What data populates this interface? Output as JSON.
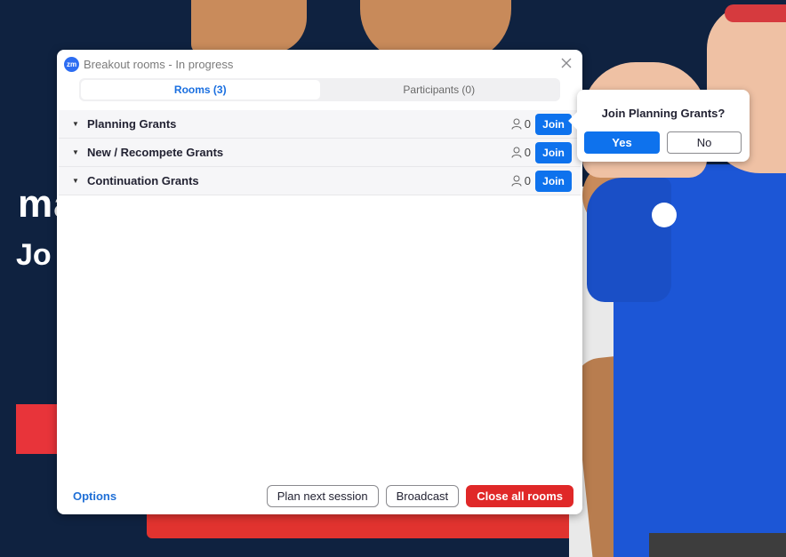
{
  "window": {
    "logo_text": "zm",
    "title": "Breakout rooms - In progress"
  },
  "tabs": [
    {
      "label": "Rooms (3)",
      "active": true
    },
    {
      "label": "Participants (0)",
      "active": false
    }
  ],
  "rooms": [
    {
      "name": "Planning Grants",
      "count": "0",
      "join_label": "Join"
    },
    {
      "name": "New / Recompete Grants",
      "count": "0",
      "join_label": "Join"
    },
    {
      "name": "Continuation Grants",
      "count": "0",
      "join_label": "Join"
    }
  ],
  "footer": {
    "options_label": "Options",
    "plan_next_label": "Plan next session",
    "broadcast_label": "Broadcast",
    "close_all_label": "Close all rooms"
  },
  "popover": {
    "question": "Join Planning Grants?",
    "yes_label": "Yes",
    "no_label": "No"
  },
  "background": {
    "text_line_1": "ma",
    "text_line_2": "Jo"
  },
  "colors": {
    "primary_blue": "#0e72ed",
    "danger_red": "#e02828",
    "link_blue": "#1f6fd6",
    "background_navy": "#0f2240"
  }
}
